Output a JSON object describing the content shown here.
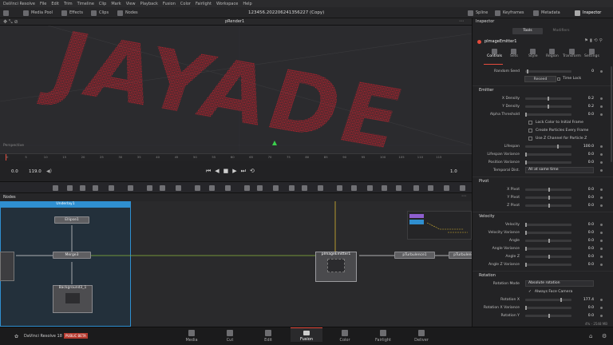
{
  "menu": [
    "DaVinci Resolve",
    "File",
    "Edit",
    "Trim",
    "Timeline",
    "Clip",
    "Mark",
    "View",
    "Playback",
    "Fusion",
    "Color",
    "Fairlight",
    "Workspace",
    "Help"
  ],
  "toolbar": {
    "media_pool": "Media Pool",
    "effects": "Effects",
    "clips": "Clips",
    "nodes": "Nodes",
    "project_title": "123456.202206241356227 (Copy)",
    "spline": "Spline",
    "keyframes": "Keyframes",
    "metadata": "Metadata",
    "inspector": "Inspector"
  },
  "viewer": {
    "title": "pRender1",
    "text_render": "JAYADE",
    "perspective": "Perspective"
  },
  "ruler": [
    "0",
    "5",
    "10",
    "15",
    "20",
    "25",
    "30",
    "35",
    "40",
    "45",
    "50",
    "55",
    "60",
    "65",
    "70",
    "75",
    "80",
    "85",
    "90",
    "95",
    "100",
    "105",
    "110",
    "115"
  ],
  "transport": {
    "start": "0.0",
    "end": "119.0",
    "current": "1.0"
  },
  "nodes_panel": {
    "title": "Nodes",
    "underlay": "Underlay1",
    "ellipse": "Ellipse1",
    "merge": "Merge3",
    "background": "Background3_1",
    "emitter": "pImageEmitter1",
    "turb1": "pTurbulence1",
    "turb2": "pTurbulence"
  },
  "inspector": {
    "title": "Inspector",
    "tabs_top": {
      "tools": "Tools",
      "modifiers": "Modifiers"
    },
    "node_name": "pImageEmitter1",
    "subtabs": [
      "Controls",
      "Sets",
      "Style",
      "Region",
      "Transform",
      "Settings"
    ],
    "random_seed": {
      "label": "Random Seed",
      "value": "0"
    },
    "reseed": "Reseed",
    "time_lock": "Time Lock",
    "emitter_section": "Emitter",
    "x_density": {
      "label": "X Density",
      "value": "0.2"
    },
    "y_density": {
      "label": "Y Density",
      "value": "0.2"
    },
    "alpha_threshold": {
      "label": "Alpha Threshold",
      "value": "0.0"
    },
    "lock_color": "Lock Color to Initial Frame",
    "create_particles": "Create Particles Every Frame",
    "use_z": "Use Z Channel for Particle Z",
    "lifespan": {
      "label": "Lifespan",
      "value": "100.0"
    },
    "lifespan_var": {
      "label": "Lifespan Variance",
      "value": "0.0"
    },
    "position_var": {
      "label": "Position Variance",
      "value": "0.0"
    },
    "temporal": {
      "label": "Temporal Dist.",
      "value": "All at same time"
    },
    "pivot_section": "Pivot",
    "x_pivot": {
      "label": "X Pivot",
      "value": "0.0"
    },
    "y_pivot": {
      "label": "Y Pivot",
      "value": "0.0"
    },
    "z_pivot": {
      "label": "Z Pivot",
      "value": "0.0"
    },
    "velocity_section": "Velocity",
    "velocity": {
      "label": "Velocity",
      "value": "0.0"
    },
    "velocity_var": {
      "label": "Velocity Variance",
      "value": "0.0"
    },
    "angle": {
      "label": "Angle",
      "value": "0.0"
    },
    "angle_var": {
      "label": "Angle Variance",
      "value": "0.0"
    },
    "angle_z": {
      "label": "Angle Z",
      "value": "0.0"
    },
    "angle_z_var": {
      "label": "Angle Z Variance",
      "value": "0.0"
    },
    "rotation_section": "Rotation",
    "rotation_mode": {
      "label": "Rotation Mode",
      "value": "Absolute rotation"
    },
    "always_face": "Always Face Camera",
    "rot_x": {
      "label": "Rotation X",
      "value": "177.4"
    },
    "rot_x_var": {
      "label": "Rotation X Variance",
      "value": "0.0"
    },
    "rot_y": {
      "label": "Rotation Y",
      "value": "0.0"
    }
  },
  "pagebar": {
    "app": "DaVinci Resolve 18",
    "beta": "PUBLIC BETA",
    "pages": [
      "Media",
      "Cut",
      "Edit",
      "Fusion",
      "Color",
      "Fairlight",
      "Deliver"
    ],
    "memory": "4% - 2548 MB"
  },
  "colors": {
    "accent": "#e64b3c",
    "particles": "#c4212d",
    "underlay": "#2f8fd0",
    "link_green": "#8ab83c",
    "link_yellow": "#d8b530"
  }
}
